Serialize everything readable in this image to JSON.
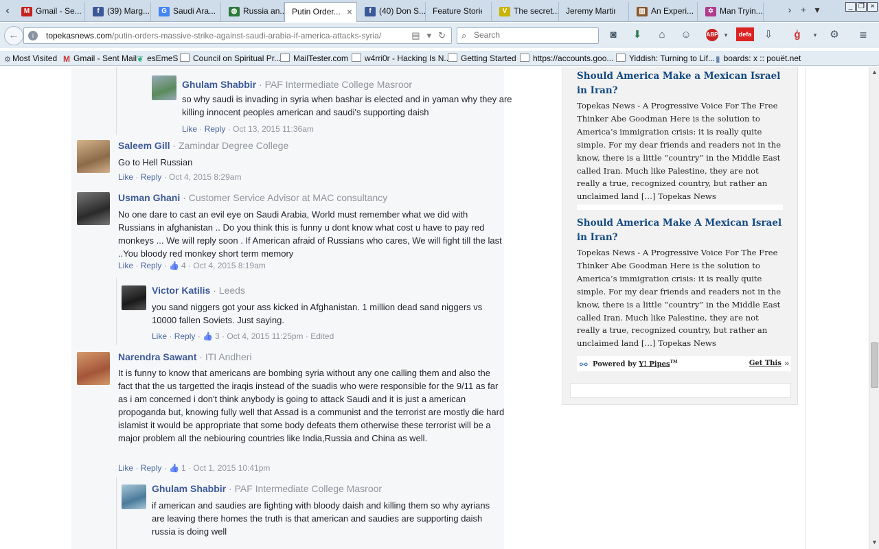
{
  "browser": {
    "tabs": [
      {
        "label": "Gmail - Se...",
        "icon": "gmail-icon",
        "color": "#c5221f"
      },
      {
        "label": "(39) Marg...",
        "icon": "facebook-icon",
        "color": "#3b5998"
      },
      {
        "label": "Saudi Ara...",
        "icon": "google-icon",
        "color": "#4285f4"
      },
      {
        "label": "Russia an...",
        "icon": "globe-icon",
        "color": "#2b7a3b"
      },
      {
        "label": "Putin Order...",
        "icon": "",
        "color": "",
        "active": true
      },
      {
        "label": "(40) Don S...",
        "icon": "facebook-icon",
        "color": "#3b5998"
      },
      {
        "label": "Feature Stories",
        "icon": "",
        "color": ""
      },
      {
        "label": "The secret...",
        "icon": "v-icon",
        "color": "#c9b400"
      },
      {
        "label": "Jeremy Martin",
        "icon": "",
        "color": ""
      },
      {
        "label": "An Experi...",
        "icon": "book-icon",
        "color": "#8a5a2b"
      },
      {
        "label": "Man Tryin...",
        "icon": "star-of-david-icon",
        "color": "#b03a8c"
      }
    ],
    "tab_close_glyph": "×",
    "url_domain": "topekasnews.com",
    "url_path": "/putin-orders-massive-strike-against-saudi-arabia-if-america-attacks-syria/",
    "search_placeholder": "Search",
    "defa_label": "defa",
    "abp_label": "ABP",
    "bookmarks": [
      {
        "label": "Most Visited",
        "icon": "gear"
      },
      {
        "label": "Gmail - Sent Mail",
        "icon": "m"
      },
      {
        "label": "esEmeS",
        "icon": "leaf"
      },
      {
        "label": "Council on Spiritual Pr...",
        "icon": "page"
      },
      {
        "label": "MailTester.com",
        "icon": "page"
      },
      {
        "label": "w4rri0r - Hacking Is N...",
        "icon": "page"
      },
      {
        "label": "Getting Started",
        "icon": "page"
      },
      {
        "label": "https://accounts.goo...",
        "icon": "page"
      },
      {
        "label": "Yiddish: Turning to Lif...",
        "icon": "page"
      },
      {
        "label": "boards: x :: pouët.net",
        "icon": "file"
      }
    ]
  },
  "comments": [
    {
      "name": "Ghulam Shabbir",
      "sep": " · ",
      "affiliation": "PAF Intermediate College Masroor",
      "text": "so why saudi is invading in syria when bashar is elected and in yaman why they are killing innocent peoples american and saudi's supporting daish",
      "like": "Like",
      "reply": "Reply",
      "dot": " · ",
      "likes": "",
      "date": "Oct 13, 2015 11:36am",
      "edited": ""
    },
    {
      "name": "Saleem Gill",
      "sep": " · ",
      "affiliation": "Zamindar Degree College",
      "text": "Go to Hell Russian",
      "like": "Like",
      "reply": "Reply",
      "dot": " · ",
      "likes": "",
      "date": "Oct 4, 2015 8:29am",
      "edited": ""
    },
    {
      "name": "Usman Ghani",
      "sep": " · ",
      "affiliation": "Customer Service Advisor at MAC consultancy",
      "text": "No one dare to cast an evil eye on Saudi Arabia, World must remember what we did with Russians in afghanistan .. Do you think this is funny u dont know what cost u have to pay red monkeys ... We will reply soon . If American afraid of Russians who cares, We will fight till the last ..You bloody red monkey short term memory",
      "like": "Like",
      "reply": "Reply",
      "dot": " · ",
      "likes": "4",
      "date": "Oct 4, 2015 8:19am",
      "edited": ""
    },
    {
      "name": "Victor Katilis",
      "sep": " · ",
      "affiliation": "Leeds",
      "text": "you sand niggers got your ass kicked in Afghanistan. 1 million dead sand niggers vs 10000 fallen Soviets. Just saying.",
      "like": "Like",
      "reply": "Reply",
      "dot": " · ",
      "likes": "3",
      "date": "Oct 4, 2015 11:25pm",
      "edited": "Edited"
    },
    {
      "name": "Narendra Sawant",
      "sep": " · ",
      "affiliation": "ITI Andheri",
      "text": "It is funny to know that americans are bombing syria without any one calling them and also the fact that the us targetted the iraqis instead of the suadis who were responsible for the 9/11 as far as i am concerned i don't think anybody is going to attack Saudi and it is just a american propoganda but, knowing fully well that Assad is a communist and the terrorist are mostly die hard islamist it would be appropriate that some body defeats them otherwise these terrorist will be a major problem all the nebiouring countries like India,Russia and China as well.",
      "like": "Like",
      "reply": "Reply",
      "dot": " · ",
      "likes": "1",
      "date": "Oct 1, 2015 10:41pm",
      "edited": ""
    },
    {
      "name": "Ghulam Shabbir",
      "sep": " · ",
      "affiliation": "PAF Intermediate College Masroor",
      "text": "if american and saudies are fighting with bloody daish and killing them so why ayrians are leaving there homes the truth is that american and saudies are supporting daish russia is doing well",
      "like": "",
      "reply": "",
      "dot": "",
      "likes": "",
      "date": "",
      "edited": ""
    }
  ],
  "sidebar": {
    "items": [
      {
        "title": "Should America Make a Mexican Israel in Iran?",
        "desc": "Topekas News - A Progressive Voice For The Free Thinker Abe Goodman Here is the solution to America’s immigration crisis:  it is really quite simple. For my dear friends and readers not in the know, there is a little “country” in the Middle East called Iran.  Much like Palestine, they are not really a true, recognized country, but rather an unclaimed land […] Topekas News"
      },
      {
        "title": "Should America Make A Mexican Israel in Iran?",
        "desc": "Topekas News - A Progressive Voice For The Free Thinker Abe Goodman Here is the solution to America’s immigration crisis:  it is really quite simple. For my dear friends and readers not in the know, there is a little “country” in the Middle East called Iran.  Much like Palestine, they are not really a true, recognized country, but rather an unclaimed land […] Topekas News"
      }
    ],
    "powered_prefix": "Powered by ",
    "powered_link": "Y! Pipes",
    "powered_tm": "TM",
    "get_this": "Get This",
    "get_this_arrow": "»"
  }
}
